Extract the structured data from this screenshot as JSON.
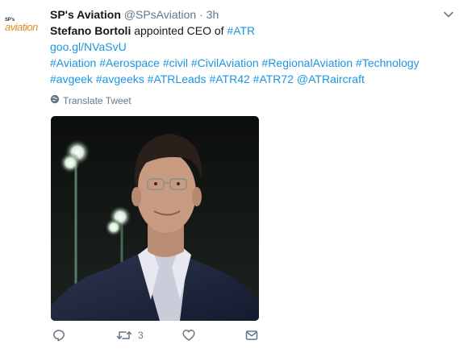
{
  "avatar": {
    "small_text": "SP's",
    "word": "aviation"
  },
  "header": {
    "name": "SP's Aviation",
    "handle": "@SPsAviation",
    "separator": "·",
    "time": "3h"
  },
  "text": {
    "line1": {
      "bold": "Stefano Bortoli",
      "middle": " appointed CEO of ",
      "link": "#ATR"
    },
    "line2": "goo.gl/NVaSvU",
    "line3": [
      "#Aviation",
      "#Aerospace",
      "#civil",
      "#CivilAviation",
      "#RegionalAviation",
      "#Technology"
    ],
    "line4": [
      "#avgeek",
      "#avgeeks",
      "#ATRLeads",
      "#ATR42",
      "#ATR72",
      "@ATRaircraft"
    ]
  },
  "translate": {
    "label": "Translate Tweet",
    "icon": "globe-icon"
  },
  "actions": {
    "reply": {
      "icon": "reply-icon",
      "count": ""
    },
    "retweet": {
      "icon": "retweet-icon",
      "count": "3"
    },
    "like": {
      "icon": "heart-icon",
      "count": ""
    },
    "dm": {
      "icon": "envelope-icon",
      "count": ""
    }
  },
  "colors": {
    "link": "#1b95e0",
    "muted": "#657786",
    "brand_orange": "#e58a1f"
  }
}
